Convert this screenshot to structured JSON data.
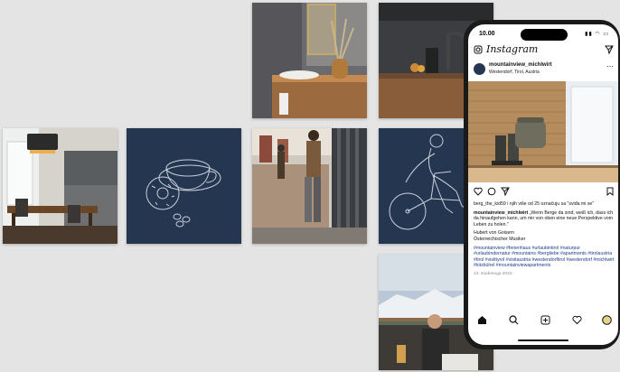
{
  "phone": {
    "status": {
      "time": "10.00",
      "icons": "▮▮ ◠ ▭"
    },
    "app": {
      "logo": "Instagram"
    },
    "post": {
      "username": "mountainview_michlwirt",
      "location": "Westendorf, Tirol, Austria",
      "likes_text": "berg_the_kid59 i njih više od 25 označuju sa \"sviđa mi se\"",
      "caption_user": "mountainview_michlwirt",
      "caption": "„Wenn Berge da sind, weiß ich, dass ich da hinaufgehen kann, um mir von oben eine neue Perspektive vom Leben zu holen.\"",
      "author": "Hubert von Goisern",
      "author_desc": "Österreichischer Musiker",
      "hashtags": "#mountainview #ferienhaus #urlaubintirol #naturpur #urlaubindernatur #mountains #bergliebe #apartments #tirolaustria #tirol #visittyrol #visitaustria #westendorftirol #westendorf #michlwirt #kitzbühel #mountainviewapartments",
      "date": "13. studenoga 2022. ·"
    },
    "nav": [
      "home",
      "search",
      "create",
      "activity",
      "profile"
    ]
  },
  "colors": {
    "navy": "#243650",
    "hashtag": "#1f3c8c",
    "wood": "#b08a5e"
  }
}
